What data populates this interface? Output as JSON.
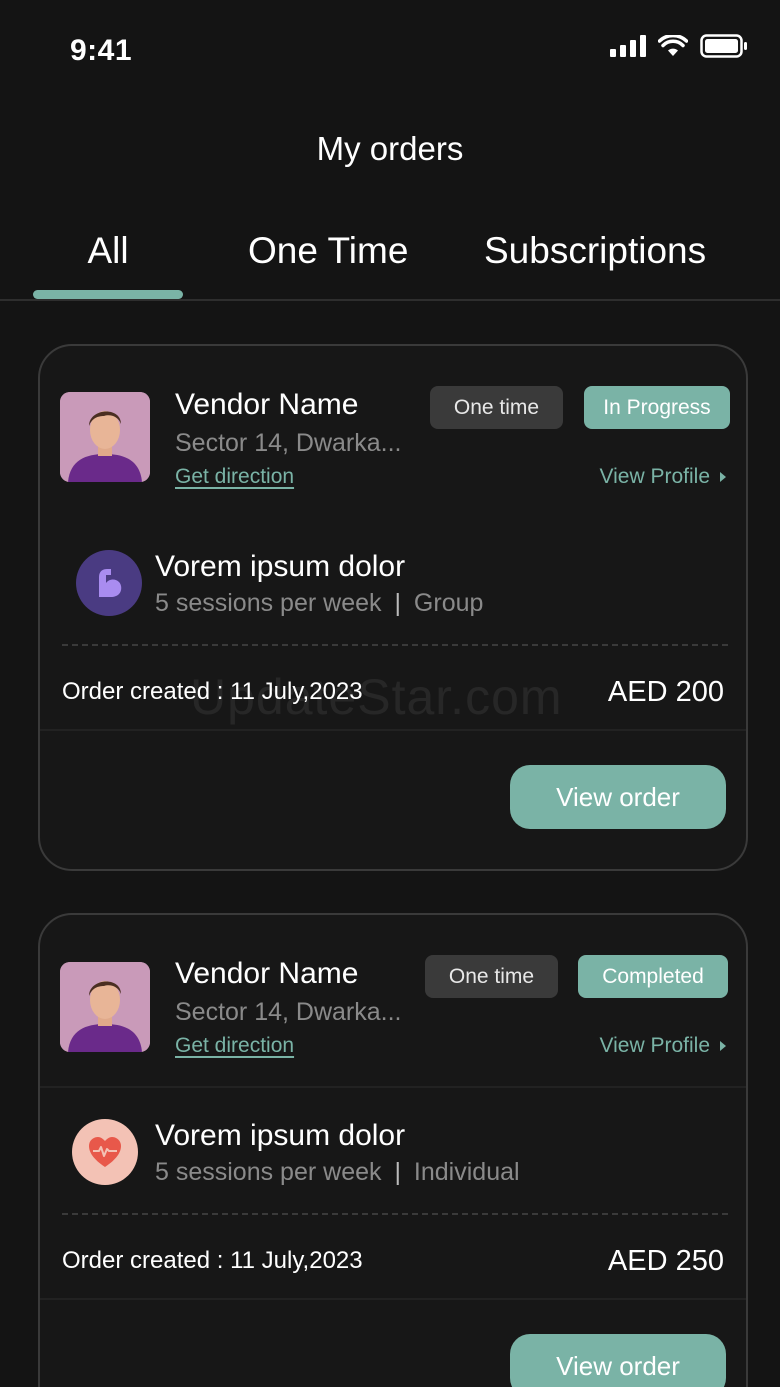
{
  "status_bar": {
    "time": "9:41"
  },
  "header": {
    "title": "My orders"
  },
  "tabs": [
    {
      "label": "All",
      "active": true
    },
    {
      "label": "One Time",
      "active": false
    },
    {
      "label": "Subscriptions",
      "active": false
    }
  ],
  "orders": [
    {
      "vendor_name": "Vendor Name",
      "address": "Sector 14, Dwarka...",
      "direction_label": "Get direction",
      "type_badge": "One time",
      "status_badge": "In Progress",
      "profile_link": "View Profile",
      "service_title": "Vorem ipsum dolor",
      "service_frequency": "5 sessions per week",
      "service_separator": "|",
      "service_kind": "Group",
      "service_icon": "muscle-icon",
      "order_created": "Order created : 11 July,2023",
      "price": "AED 200",
      "button_label": "View order"
    },
    {
      "vendor_name": "Vendor Name",
      "address": "Sector 14, Dwarka...",
      "direction_label": "Get direction",
      "type_badge": "One time",
      "status_badge": "Completed",
      "profile_link": "View Profile",
      "service_title": "Vorem ipsum dolor",
      "service_frequency": "5 sessions per week",
      "service_separator": "|",
      "service_kind": "Individual",
      "service_icon": "heartbeat-icon",
      "order_created": "Order created : 11 July,2023",
      "price": "AED 250",
      "button_label": "View order"
    }
  ],
  "watermark": "UpdateStar.com",
  "colors": {
    "background": "#141414",
    "accent": "#7ab3a6",
    "badge_neutral": "#3a3a3a",
    "muscle_icon_bg": "#4a3b82",
    "heart_icon_bg": "#f3c2b5"
  }
}
